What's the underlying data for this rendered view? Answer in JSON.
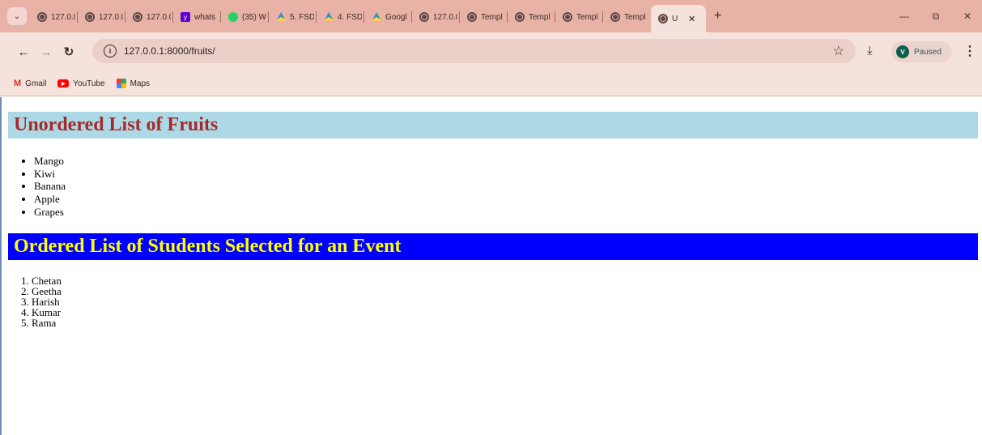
{
  "browser": {
    "tabs": [
      {
        "label": "127.0.0",
        "icon": "globe-icon"
      },
      {
        "label": "127.0.0",
        "icon": "globe-icon"
      },
      {
        "label": "127.0.0",
        "icon": "globe-icon"
      },
      {
        "label": "whats",
        "icon": "yahoo-icon"
      },
      {
        "label": "(35) W",
        "icon": "whatsapp-icon"
      },
      {
        "label": "5. FSD",
        "icon": "drive-icon"
      },
      {
        "label": "4. FSD",
        "icon": "drive-icon"
      },
      {
        "label": "Googl",
        "icon": "drive-icon"
      },
      {
        "label": "127.0.0",
        "icon": "globe-icon"
      },
      {
        "label": "Templ",
        "icon": "globe-icon"
      },
      {
        "label": "Templ",
        "icon": "globe-icon"
      },
      {
        "label": "Templ",
        "icon": "globe-icon"
      },
      {
        "label": "Templ",
        "icon": "globe-icon"
      }
    ],
    "active_tab": {
      "label": "U",
      "icon": "globe-icon"
    },
    "url": "127.0.0.1:8000/fruits/",
    "profile": {
      "initial": "V",
      "status": "Paused"
    },
    "bookmarks": [
      {
        "label": "Gmail",
        "icon": "gmail-icon"
      },
      {
        "label": "YouTube",
        "icon": "youtube-icon"
      },
      {
        "label": "Maps",
        "icon": "maps-icon"
      }
    ]
  },
  "page": {
    "fruits_heading": "Unordered List of Fruits",
    "fruits": [
      "Mango",
      "Kiwi",
      "Banana",
      "Apple",
      "Grapes"
    ],
    "students_heading": "Ordered List of Students Selected for an Event",
    "students": [
      "Chetan",
      "Geetha",
      "Harish",
      "Kumar",
      "Rama"
    ]
  },
  "colors": {
    "fruits_heading_bg": "#add8e6",
    "fruits_heading_text": "#a52a2a",
    "students_heading_bg": "#0000ff",
    "students_heading_text": "#ffff00"
  }
}
